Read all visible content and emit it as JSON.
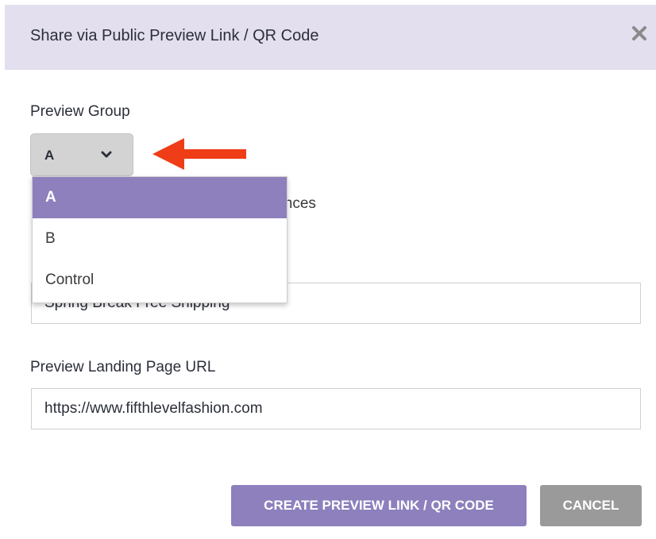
{
  "modal": {
    "title": "Share via Public Preview Link / QR Code",
    "close_icon": "close-x-icon"
  },
  "preview_group": {
    "label": "Preview Group",
    "selected_value": "A",
    "chevron_icon": "chevron-down-icon",
    "options": [
      "A",
      "B",
      "Control"
    ],
    "partially_hidden_text": "xperiences"
  },
  "experience_name": {
    "value": "Spring Break Free Shipping"
  },
  "landing_url": {
    "label": "Preview Landing Page URL",
    "value": "https://www.fifthlevelfashion.com"
  },
  "actions": {
    "create_label": "CREATE PREVIEW LINK / QR CODE",
    "cancel_label": "CANCEL"
  },
  "annotation": {
    "arrow_icon": "red-arrow-left-icon",
    "arrow_color": "#ef3e17"
  },
  "colors": {
    "header_bg": "#e3dfee",
    "accent": "#8d80bd",
    "cancel_bg": "#9a9a9a",
    "select_bg": "#d3d3d3"
  }
}
